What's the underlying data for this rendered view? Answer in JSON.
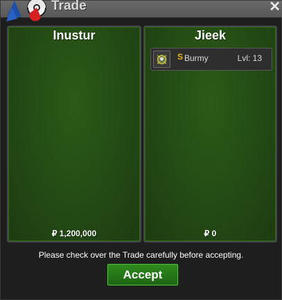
{
  "window": {
    "title": "Trade",
    "close_label": "✕"
  },
  "left_panel": {
    "player_name": "Inustur",
    "money": "₽ 1,200,000"
  },
  "right_panel": {
    "player_name": "Jieek",
    "money": "₽ 0",
    "items": [
      {
        "badge": "S",
        "name": "Burmy",
        "level": "Lvl: 13"
      }
    ]
  },
  "notice": "Please check over the Trade carefully before accepting.",
  "accept_label": "Accept",
  "colors": {
    "panel_green": "#234a14",
    "accept_green": "#2f8a1e",
    "badge_gold": "#e6b400"
  },
  "icons": {
    "logo": "pokeball-logo-icon",
    "close": "close-icon",
    "item": "pokemon-sprite-icon"
  }
}
